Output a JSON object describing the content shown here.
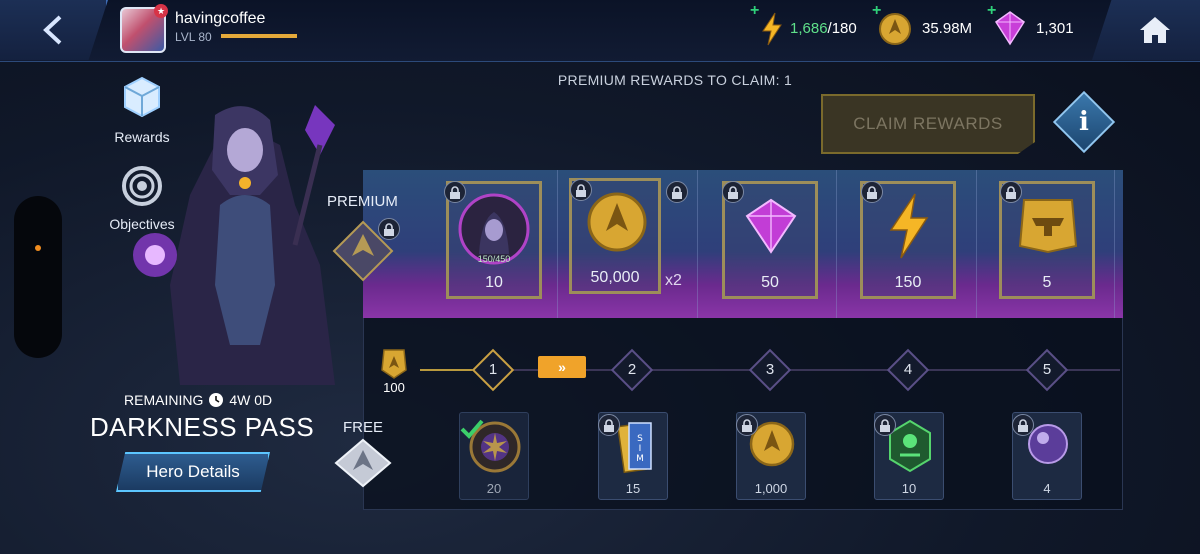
{
  "player": {
    "name": "havingcoffee",
    "level": "LVL 80",
    "xp_progress": 1.0
  },
  "resources": {
    "energy_current": "1,686",
    "energy_max": "/180",
    "gold": "35.98M",
    "gems": "1,301",
    "plus": "+"
  },
  "nav": {
    "rewards_label": "Rewards",
    "objectives_label": "Objectives"
  },
  "pass": {
    "remaining_label": "REMAINING",
    "remaining_value": "4W 0D",
    "title": "DARKNESS PASS",
    "hero_details_label": "Hero Details"
  },
  "header": {
    "premium_claim_text": "PREMIUM REWARDS TO CLAIM: 1",
    "claim_button_label": "CLAIM REWARDS",
    "info_label": "i"
  },
  "tiers": {
    "premium_label": "PREMIUM",
    "free_label": "FREE",
    "token_count": "100",
    "skip_label": "»"
  },
  "premium_rewards": [
    {
      "icon": "raven-shard-icon",
      "amount": "10",
      "progress": "150/450"
    },
    {
      "icon": "gold-coin-icon",
      "amount": "50,000",
      "multiplier": "x2"
    },
    {
      "icon": "gem-icon",
      "amount": "50"
    },
    {
      "icon": "energy-icon",
      "amount": "150"
    },
    {
      "icon": "anvil-icon",
      "amount": "5"
    }
  ],
  "levels": [
    "1",
    "2",
    "3",
    "4",
    "5"
  ],
  "free_rewards": [
    {
      "icon": "gear-emblem-icon",
      "amount": "20",
      "claimed": true
    },
    {
      "icon": "sim-ticket-icon",
      "amount": "15"
    },
    {
      "icon": "gold-coin-icon",
      "amount": "1,000"
    },
    {
      "icon": "green-mask-icon",
      "amount": "10"
    },
    {
      "icon": "orb-icon",
      "amount": "4"
    }
  ],
  "colors": {
    "accent_gold": "#e4a93a",
    "premium_purple": "#8a35a8",
    "hero_button_glow": "#5cc6ff",
    "skip_orange": "#f0a32a"
  }
}
